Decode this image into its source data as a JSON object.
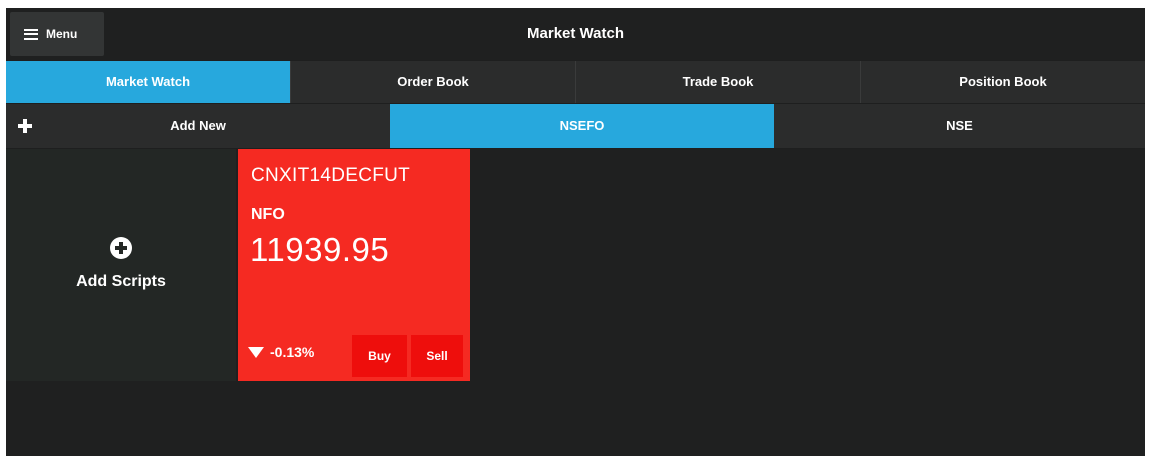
{
  "header": {
    "menu_label": "Menu",
    "title": "Market Watch"
  },
  "main_tabs": [
    {
      "label": "Market Watch",
      "active": true
    },
    {
      "label": "Order Book",
      "active": false
    },
    {
      "label": "Trade Book",
      "active": false
    },
    {
      "label": "Position Book",
      "active": false
    }
  ],
  "sub_tabs": {
    "add_new": "Add New",
    "nsefo": "NSEFO",
    "nse": "NSE",
    "active": "NSEFO"
  },
  "add_scripts": {
    "label": "Add Scripts",
    "icon": "plus-circle-icon"
  },
  "card": {
    "symbol": "CNXIT14DECFUT",
    "exchange": "NFO",
    "price": "11939.95",
    "change": "-0.13%",
    "direction_icon": "down-arrow-icon",
    "buy_label": "Buy",
    "sell_label": "Sell"
  },
  "colors": {
    "accent": "#27a8dd",
    "card_red": "#f52a22",
    "button_red": "#ee0e0c",
    "background": "#1f2020",
    "tab_bg": "#2b2c2c"
  }
}
